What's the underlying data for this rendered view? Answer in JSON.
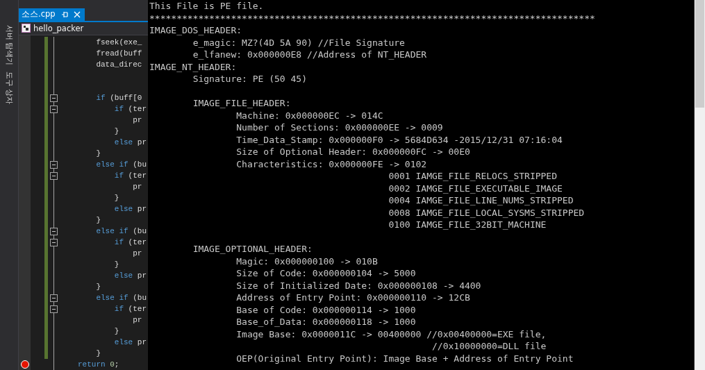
{
  "side_tabs": [
    {
      "label": "서버 탐색기",
      "selected": false
    },
    {
      "label": "도구 상자",
      "selected": false
    }
  ],
  "editor": {
    "tab": {
      "label": "소스.cpp",
      "selected": true
    },
    "navigation": "hello_packer",
    "lines": [
      {
        "modified": true,
        "tokens": [
          {
            "kind": "plain",
            "text": "    fseek(exe_"
          }
        ]
      },
      {
        "modified": true,
        "tokens": [
          {
            "kind": "plain",
            "text": "    fread(buff"
          }
        ]
      },
      {
        "modified": true,
        "tokens": [
          {
            "kind": "plain",
            "text": "    data_direc"
          }
        ]
      },
      {
        "modified": true
      },
      {
        "modified": true
      },
      {
        "modified": true,
        "expanded": true,
        "tokens": [
          {
            "kind": "keyword",
            "text": "    if"
          },
          {
            "kind": "plain",
            "text": " (buff[0"
          }
        ]
      },
      {
        "modified": true,
        "expanded": true,
        "tokens": [
          {
            "kind": "keyword",
            "text": "        if"
          },
          {
            "kind": "plain",
            "text": " (ter"
          }
        ]
      },
      {
        "modified": true,
        "tokens": [
          {
            "kind": "plain",
            "text": "            pr"
          }
        ]
      },
      {
        "modified": true,
        "tokens": [
          {
            "kind": "plain",
            "text": "        }"
          }
        ]
      },
      {
        "modified": true,
        "tokens": [
          {
            "kind": "keyword",
            "text": "        else"
          },
          {
            "kind": "plain",
            "text": " pr"
          }
        ]
      },
      {
        "modified": true,
        "tokens": [
          {
            "kind": "plain",
            "text": "    }"
          }
        ]
      },
      {
        "modified": true,
        "expanded": true,
        "tokens": [
          {
            "kind": "keyword",
            "text": "    else if"
          },
          {
            "kind": "plain",
            "text": " (bu"
          }
        ]
      },
      {
        "modified": true,
        "expanded": true,
        "tokens": [
          {
            "kind": "keyword",
            "text": "        if"
          },
          {
            "kind": "plain",
            "text": " (ter"
          }
        ]
      },
      {
        "modified": true,
        "tokens": [
          {
            "kind": "plain",
            "text": "            pr"
          }
        ]
      },
      {
        "modified": true,
        "tokens": [
          {
            "kind": "plain",
            "text": "        }"
          }
        ]
      },
      {
        "modified": true,
        "tokens": [
          {
            "kind": "keyword",
            "text": "        else"
          },
          {
            "kind": "plain",
            "text": " pr"
          }
        ]
      },
      {
        "modified": true,
        "tokens": [
          {
            "kind": "plain",
            "text": "    }"
          }
        ]
      },
      {
        "modified": true,
        "expanded": true,
        "tokens": [
          {
            "kind": "keyword",
            "text": "    else if"
          },
          {
            "kind": "plain",
            "text": " (bu"
          }
        ]
      },
      {
        "modified": true,
        "expanded": true,
        "tokens": [
          {
            "kind": "keyword",
            "text": "        if"
          },
          {
            "kind": "plain",
            "text": " (ter"
          }
        ]
      },
      {
        "modified": true,
        "tokens": [
          {
            "kind": "plain",
            "text": "            pr"
          }
        ]
      },
      {
        "modified": true,
        "tokens": [
          {
            "kind": "plain",
            "text": "        }"
          }
        ]
      },
      {
        "modified": true,
        "tokens": [
          {
            "kind": "keyword",
            "text": "        else"
          },
          {
            "kind": "plain",
            "text": " pr"
          }
        ]
      },
      {
        "modified": true,
        "tokens": [
          {
            "kind": "plain",
            "text": "    }"
          }
        ]
      },
      {
        "modified": true,
        "expanded": true,
        "tokens": [
          {
            "kind": "keyword",
            "text": "    else if"
          },
          {
            "kind": "plain",
            "text": " (bu"
          }
        ]
      },
      {
        "modified": true,
        "expanded": true,
        "tokens": [
          {
            "kind": "keyword",
            "text": "        if"
          },
          {
            "kind": "plain",
            "text": " (ter"
          }
        ]
      },
      {
        "modified": true,
        "tokens": [
          {
            "kind": "plain",
            "text": "            pr"
          }
        ]
      },
      {
        "modified": true,
        "tokens": [
          {
            "kind": "plain",
            "text": "        }"
          }
        ]
      },
      {
        "modified": true,
        "tokens": [
          {
            "kind": "keyword",
            "text": "        else"
          },
          {
            "kind": "plain",
            "text": " pr"
          }
        ]
      },
      {
        "modified": true,
        "tokens": [
          {
            "kind": "plain",
            "text": "    }"
          }
        ]
      },
      {
        "modified": false,
        "breakpoint": true,
        "tokens": [
          {
            "kind": "keyword",
            "text": "return "
          },
          {
            "kind": "number",
            "text": "0"
          },
          {
            "kind": "plain",
            "text": ";"
          }
        ]
      }
    ]
  },
  "console": {
    "blocks": [
      [
        "This File is PE file.",
        "**********************************************************************************",
        "IMAGE_DOS_HEADER:",
        "\te_magic: MZ?(4D 5A 90) //File Signature",
        "\te_lfanew: 0x000000E8 //Address of NT_HEADER",
        "IMAGE_NT_HEADER:",
        "\tSignature: PE (50 45)"
      ],
      [
        "\tIMAGE_FILE_HEADER:",
        "\t\tMachine: 0x000000EC -> 014C",
        "\t\tNumber of Sections: 0x000000EE -> 0009",
        "\t\tTime_Data_Stamp: 0x000000F0 -> 5684D634 -2015/12/31 07:16:04",
        "\t\tSize of Optional Header: 0x000000FC -> 00E0",
        "\t\tCharacteristics: 0x000000FE -> 0102",
        "\t\t\t\t\t    0001 IAMGE_FILE_RELOCS_STRIPPED",
        "\t\t\t\t\t    0002 IAMGE_FILE_EXECUTABLE_IMAGE",
        "\t\t\t\t\t    0004 IAMGE_FILE_LINE_NUMS_STRIPPED",
        "\t\t\t\t\t    0008 IAMGE_FILE_LOCAL_SYSMS_STRIPPED",
        "\t\t\t\t\t    0100 IAMGE_FILE_32BIT_MACHINE"
      ],
      [
        "\tIMAGE_OPTIONAL_HEADER:",
        "\t\tMagic: 0x000000100 -> 010B",
        "\t\tSize of Code: 0x000000104 -> 5000",
        "\t\tSize of Initialized Date: 0x000000108 -> 4400",
        "\t\tAddress of Entry Point: 0x000000110 -> 12CB",
        "\t\tBase of Code: 0x000000114 -> 1000",
        "\t\tBase_of_Data: 0x000000118 -> 1000",
        "\t\tImage Base: 0x0000011C -> 00400000 //0x00400000=EXE file,",
        "\t\t\t\t\t\t    //0x10000000=DLL file",
        "\t\tOEP(Original Entry Point): Image Base + Address of Entry Point"
      ]
    ]
  }
}
